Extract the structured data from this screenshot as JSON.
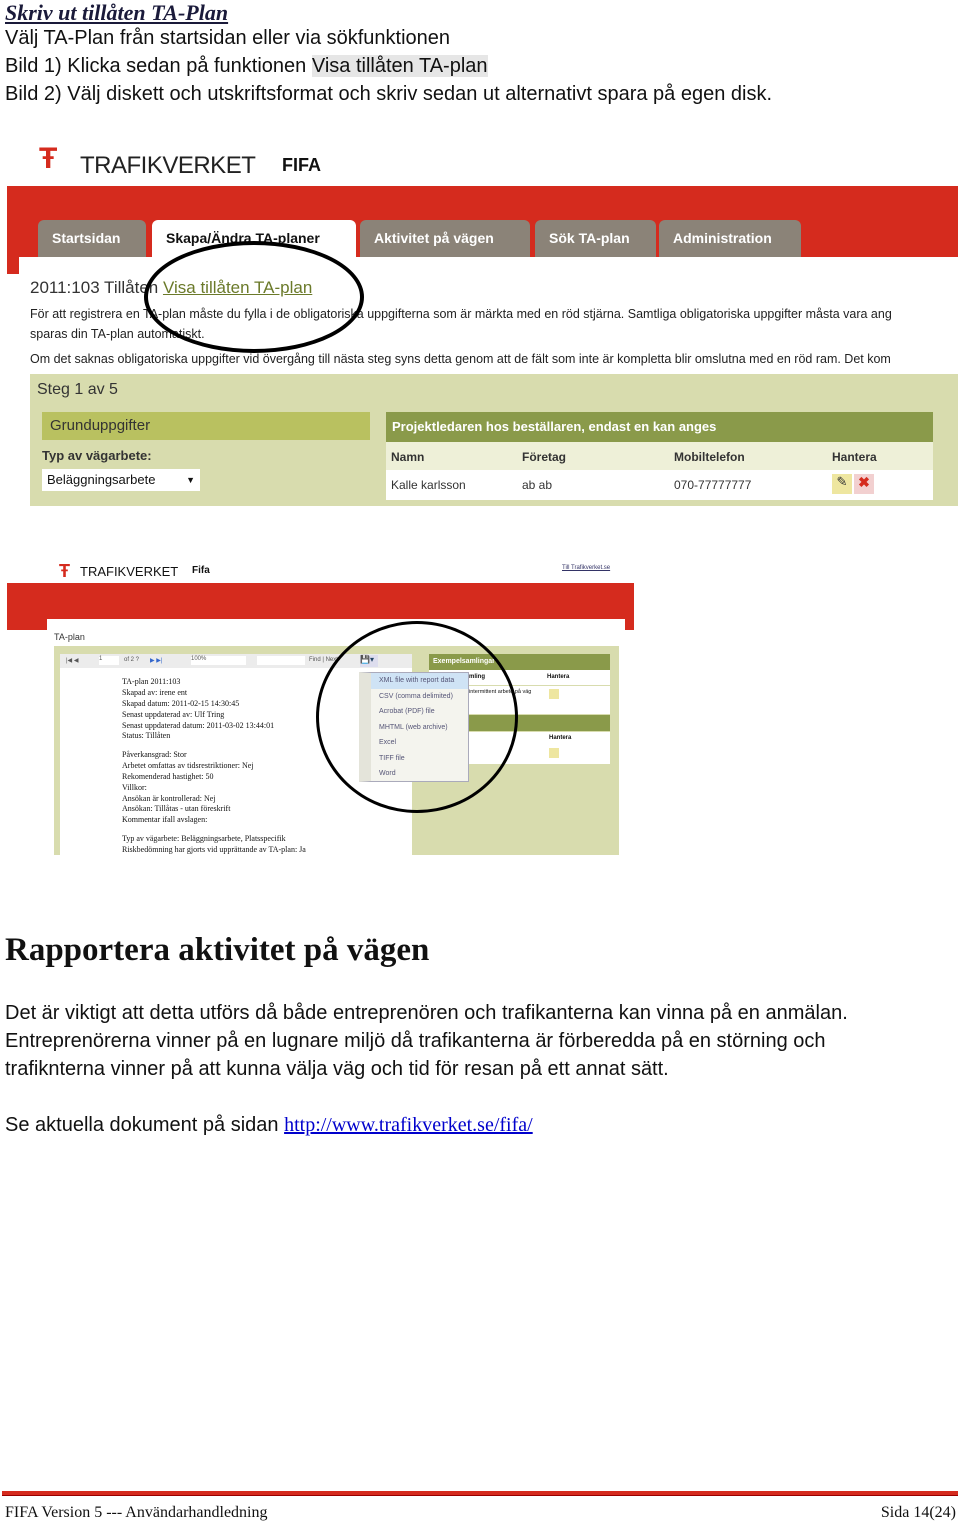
{
  "doc": {
    "title": "Skriv ut tillåten TA-Plan",
    "line1": "Välj TA-Plan från startsidan eller via sökfunktionen",
    "line2_prefix": "Bild 1) Klicka sedan på funktionen ",
    "line2_highlight": "Visa tillåten TA-plan",
    "line3": "Bild 2) Välj diskett och utskriftsformat och skriv sedan ut alternativt spara på egen disk.",
    "heading": "Rapportera aktivitet på vägen",
    "para": [
      "Det är viktigt att detta utförs då både entreprenören och trafikanterna kan vinna på en anmälan.",
      "Entreprenörerna vinner på en lugnare miljö då trafikanterna är förberedda på en störning och",
      "trafiknterna vinner på att kunna välja väg  och tid för resan på ett annat sätt."
    ],
    "link_prefix": "Se aktuella dokument på sidan ",
    "link": "http://www.trafikverket.se/fifa/"
  },
  "shot1": {
    "logo": "TRAFIKVERKET",
    "app": "FIFA",
    "tabs": [
      "Startsidan",
      "Skapa/Ändra TA-planer",
      "Aktivitet på vägen",
      "Sök TA-plan",
      "Administration"
    ],
    "plan_id": "2011:103 Tillåten",
    "plan_link": "Visa tillåten TA-plan",
    "info1": "För att registrera en TA-plan måste du fylla i de obligatoriska uppgifterna som är märkta med en röd stjärna. Samtliga obligatoriska uppgifter måsta vara ang",
    "info2": "sparas din TA-plan automatiskt.",
    "info3": "Om det saknas obligatoriska uppgifter vid övergång till nästa steg syns detta genom att de fält som inte är kompletta blir omslutna med en röd ram. Det kom",
    "step": "Steg 1 av 5",
    "left_header": "Grunduppgifter",
    "type_label": "Typ av vägarbete:",
    "type_value": "Beläggningsarbete",
    "right_header": "Projektledaren hos beställaren, endast en kan anges",
    "columns": [
      "Namn",
      "Företag",
      "Mobiltelefon",
      "Hantera"
    ],
    "row": [
      "Kalle karlsson",
      "ab ab",
      "070-77777777"
    ]
  },
  "shot2": {
    "logo": "TRAFIKVERKET",
    "app": "Fifa",
    "toplink": "Till Trafikverket.se",
    "page_title": "TA-plan",
    "page_num": "1",
    "page_of": "of 2 ?",
    "zoom": "100%",
    "find": "Find | Next",
    "report": [
      "TA-plan 2011:103",
      "Skapad av: irene ent",
      "Skapad datum: 2011-02-15 14:30:45",
      "Senast uppdaterad av: Ulf Tring",
      "Senast uppdaterad datum: 2011-03-02 13:44:01",
      "Status: Tillåten",
      "Påverkansgrad: Stor",
      "Arbetet omfattas av tidsrestriktioner: Nej",
      "Rekomenderad hastighet: 50",
      "Villkor:",
      "Ansökan är kontrollerad: Nej",
      "Ansökan: Tillåtas - utan föreskrift",
      "Kommentar ifall avslagen:",
      "Typ av vägarbete: Beläggningsarbete, Platsspecifik",
      "Riskbedömning har gjorts vid upprättande av TA-plan: Ja"
    ],
    "export_menu": [
      "XML file with report data",
      "CSV (comma delimited)",
      "Acrobat (PDF) file",
      "MHTML (web archive)",
      "Excel",
      "TIFF file",
      "Word"
    ],
    "side_header1": "Exempelsamlingar",
    "side_col1": "mling",
    "side_hantera": "Hantera",
    "side_cell": "intermittent arbete på väg",
    "side_header2": "okument"
  },
  "footer": {
    "left": "FIFA Version 5  --- Användarhandledning",
    "right": "Sida 14(24)"
  },
  "colors": {
    "brand_red": "#d52b1e",
    "tab_gray": "#8b8378",
    "panel_green": "#d8dcae",
    "header_olive": "#8a9a4a"
  }
}
